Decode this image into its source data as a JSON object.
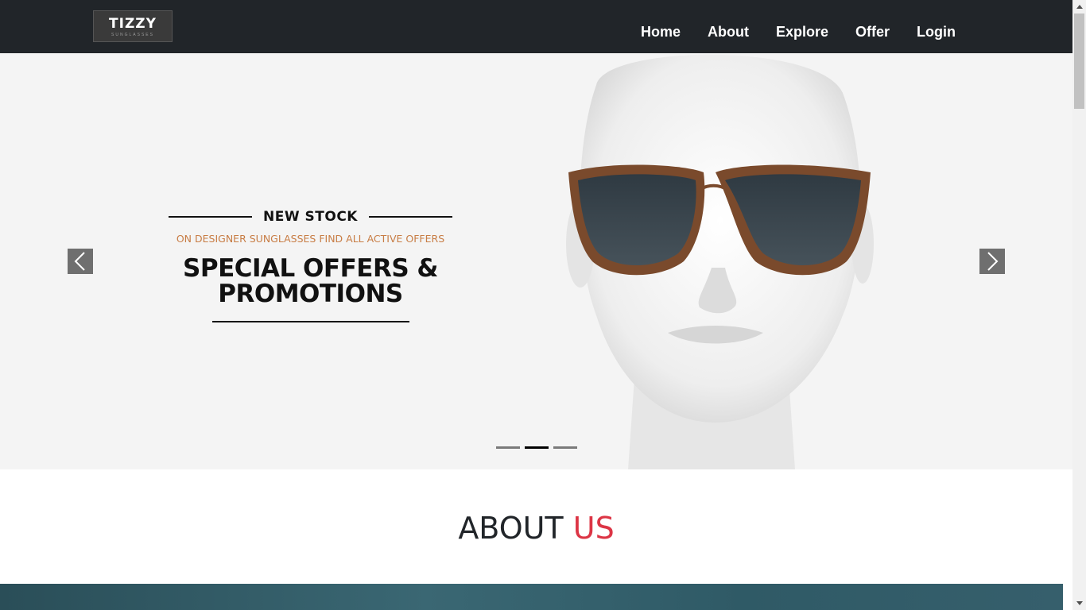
{
  "navbar": {
    "logo": {
      "main": "TIZZY",
      "sub": "SUNGLASSES"
    },
    "links": [
      {
        "label": "Home"
      },
      {
        "label": "About"
      },
      {
        "label": "Explore"
      },
      {
        "label": "Offer"
      },
      {
        "label": "Login"
      }
    ]
  },
  "hero": {
    "eyebrow": "NEW STOCK",
    "subtitle": "ON DESIGNER SUNGLASSES  FIND ALL ACTIVE OFFERS",
    "title_line1": "SPECIAL OFFERS &",
    "title_line2": "PROMOTIONS",
    "prev_icon": "chevron-left-icon",
    "next_icon": "chevron-right-icon",
    "slide_count": 3,
    "active_slide": 2
  },
  "about": {
    "heading_part1": "ABOUT",
    "heading_part2": "US"
  },
  "colors": {
    "navbar_bg": "#212529",
    "accent": "#dc3545",
    "promo_orange": "#c87d45",
    "hero_bg": "#f4f4f4"
  }
}
